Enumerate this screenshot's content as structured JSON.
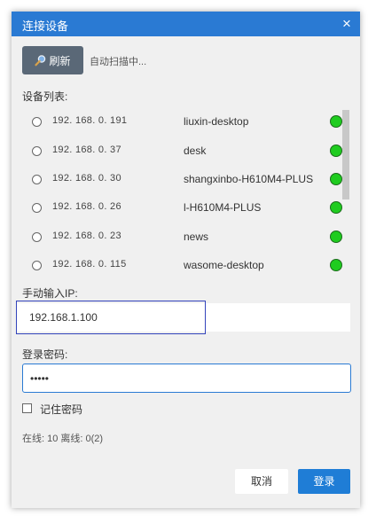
{
  "dialog": {
    "title": "连接设备",
    "close_icon": "×"
  },
  "toolbar": {
    "refresh_label": "刷新",
    "refresh_icon": "magnifier-icon",
    "scan_status": "自动扫描中..."
  },
  "device_list": {
    "label": "设备列表:",
    "items": [
      {
        "ip": "192. 168. 0. 191",
        "hostname": "liuxin-desktop",
        "online": true
      },
      {
        "ip": "192. 168. 0. 37",
        "hostname": "desk",
        "online": true
      },
      {
        "ip": "192. 168. 0. 30",
        "hostname": "shangxinbo-H610M4-PLUS",
        "online": true
      },
      {
        "ip": "192. 168. 0. 26",
        "hostname": "l-H610M4-PLUS",
        "online": true
      },
      {
        "ip": "192. 168. 0. 23",
        "hostname": "news",
        "online": true
      },
      {
        "ip": "192. 168. 0. 115",
        "hostname": "wasome-desktop",
        "online": true
      }
    ],
    "status_color": "#1fcc1f"
  },
  "manual_ip": {
    "label": "手动输入IP:",
    "value": "192.168.1.100"
  },
  "password": {
    "label": "登录密码:",
    "value": "•••••"
  },
  "remember": {
    "label": "记住密码",
    "checked": false
  },
  "summary": "在线: 10 离线: 0(2)",
  "buttons": {
    "cancel": "取消",
    "login": "登录"
  },
  "colors": {
    "accent": "#2a7ad3",
    "refresh_bg": "#5a6877"
  }
}
